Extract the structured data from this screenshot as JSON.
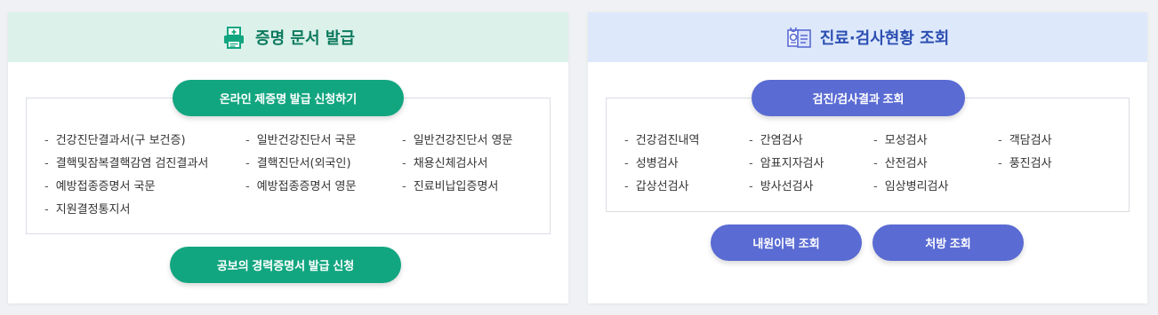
{
  "certificate": {
    "title": "증명 문서 발급",
    "apply_button": "온라인 제증명 발급 신청하기",
    "documents": [
      "건강진단결과서(구 보건증)",
      "일반건강진단서 국문",
      "일반건강진단서 영문",
      "결핵및잠복결핵감염 검진결과서",
      "결핵진단서(외국인)",
      "채용신체검사서",
      "예방접종증명서 국문",
      "예방접종증명서 영문",
      "진료비납입증명서",
      "지원결정통지서"
    ],
    "career_button": "공보의 경력증명서 발급 신청"
  },
  "inquiry": {
    "title": "진료·검사현황 조회",
    "results_button": "검진/검사결과 조회",
    "tests": [
      "건강검진내역",
      "간염검사",
      "모성검사",
      "객담검사",
      "성병검사",
      "암표지자검사",
      "산전검사",
      "풍진검사",
      "갑상선검사",
      "방사선검사",
      "임상병리검사"
    ],
    "visit_history_button": "내원이력 조회",
    "prescription_button": "처방 조회"
  },
  "icons": {
    "certificate": "printer-icon",
    "inquiry": "medical-record-icon"
  },
  "colors": {
    "green": "#12a680",
    "purple": "#5a6bd3"
  }
}
